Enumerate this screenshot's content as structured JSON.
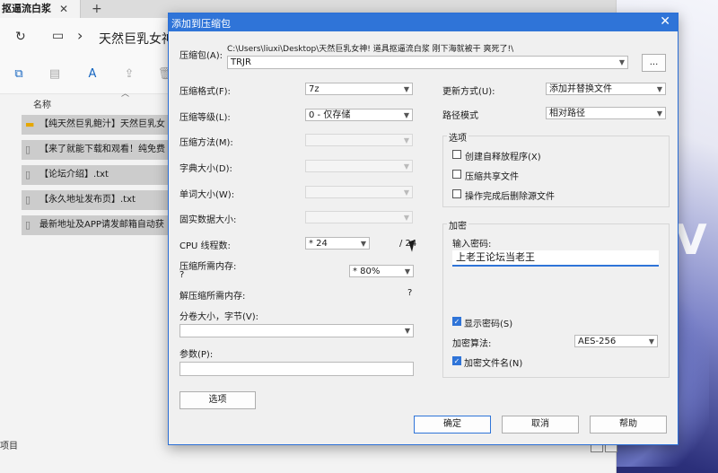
{
  "explorer": {
    "tab_title": "抠逼流白浆",
    "breadcrumb": "天然巨乳女神!",
    "column_header": "名称",
    "files": [
      {
        "name": "【纯天然巨乳鲍汁】天然巨乳女",
        "icon": "folder-icon"
      },
      {
        "name": "【来了就能下载和观看！纯免费",
        "icon": "file-icon"
      },
      {
        "name": "【论坛介绍】.txt",
        "icon": "file-icon"
      },
      {
        "name": "【永久地址发布页】.txt",
        "icon": "file-icon"
      },
      {
        "name": "最新地址及APP请发邮箱自动获",
        "icon": "file-icon"
      }
    ],
    "status_text": "项目"
  },
  "dialog": {
    "title": "添加到压缩包",
    "archive_label": "压缩包(A):",
    "archive_path": "C:\\Users\\liuxi\\Desktop\\天然巨乳女神! 道具抠逼流白浆 刚下海就被干 爽死了!\\",
    "archive_name": "TRJR",
    "browse_label": "...",
    "format_label": "压缩格式(F):",
    "format_value": "7z",
    "level_label": "压缩等级(L):",
    "level_value": "0 - 仅存储",
    "method_label": "压缩方法(M):",
    "dict_label": "字典大小(D):",
    "word_label": "单词大小(W):",
    "solid_label": "固实数据大小:",
    "cpu_label": "CPU 线程数:",
    "cpu_value": "* 24",
    "cpu_total": "/ 24",
    "mem_label": "压缩所需内存:",
    "mem_q": "?",
    "mem_value": "* 80%",
    "decomp_label": "解压缩所需内存:",
    "decomp_value": "?",
    "split_label": "分卷大小，字节(V):",
    "split_value": "",
    "params_label": "参数(P):",
    "params_value": "",
    "options_button": "选项",
    "update_label": "更新方式(U):",
    "update_value": "添加并替换文件",
    "path_label": "路径模式",
    "path_value": "相对路径",
    "options_group": "选项",
    "opt_sfx": "创建自释放程序(X)",
    "opt_shared": "压缩共享文件",
    "opt_delete": "操作完成后删除源文件",
    "encrypt_group": "加密",
    "password_label": "输入密码:",
    "password_value": "上老王论坛当老王",
    "show_password": "显示密码(S)",
    "enc_method_label": "加密算法:",
    "enc_method_value": "AES-256",
    "enc_names": "加密文件名(N)",
    "ok": "确定",
    "cancel": "取消",
    "help": "帮助"
  },
  "colors": {
    "accent": "#2f74d8"
  }
}
